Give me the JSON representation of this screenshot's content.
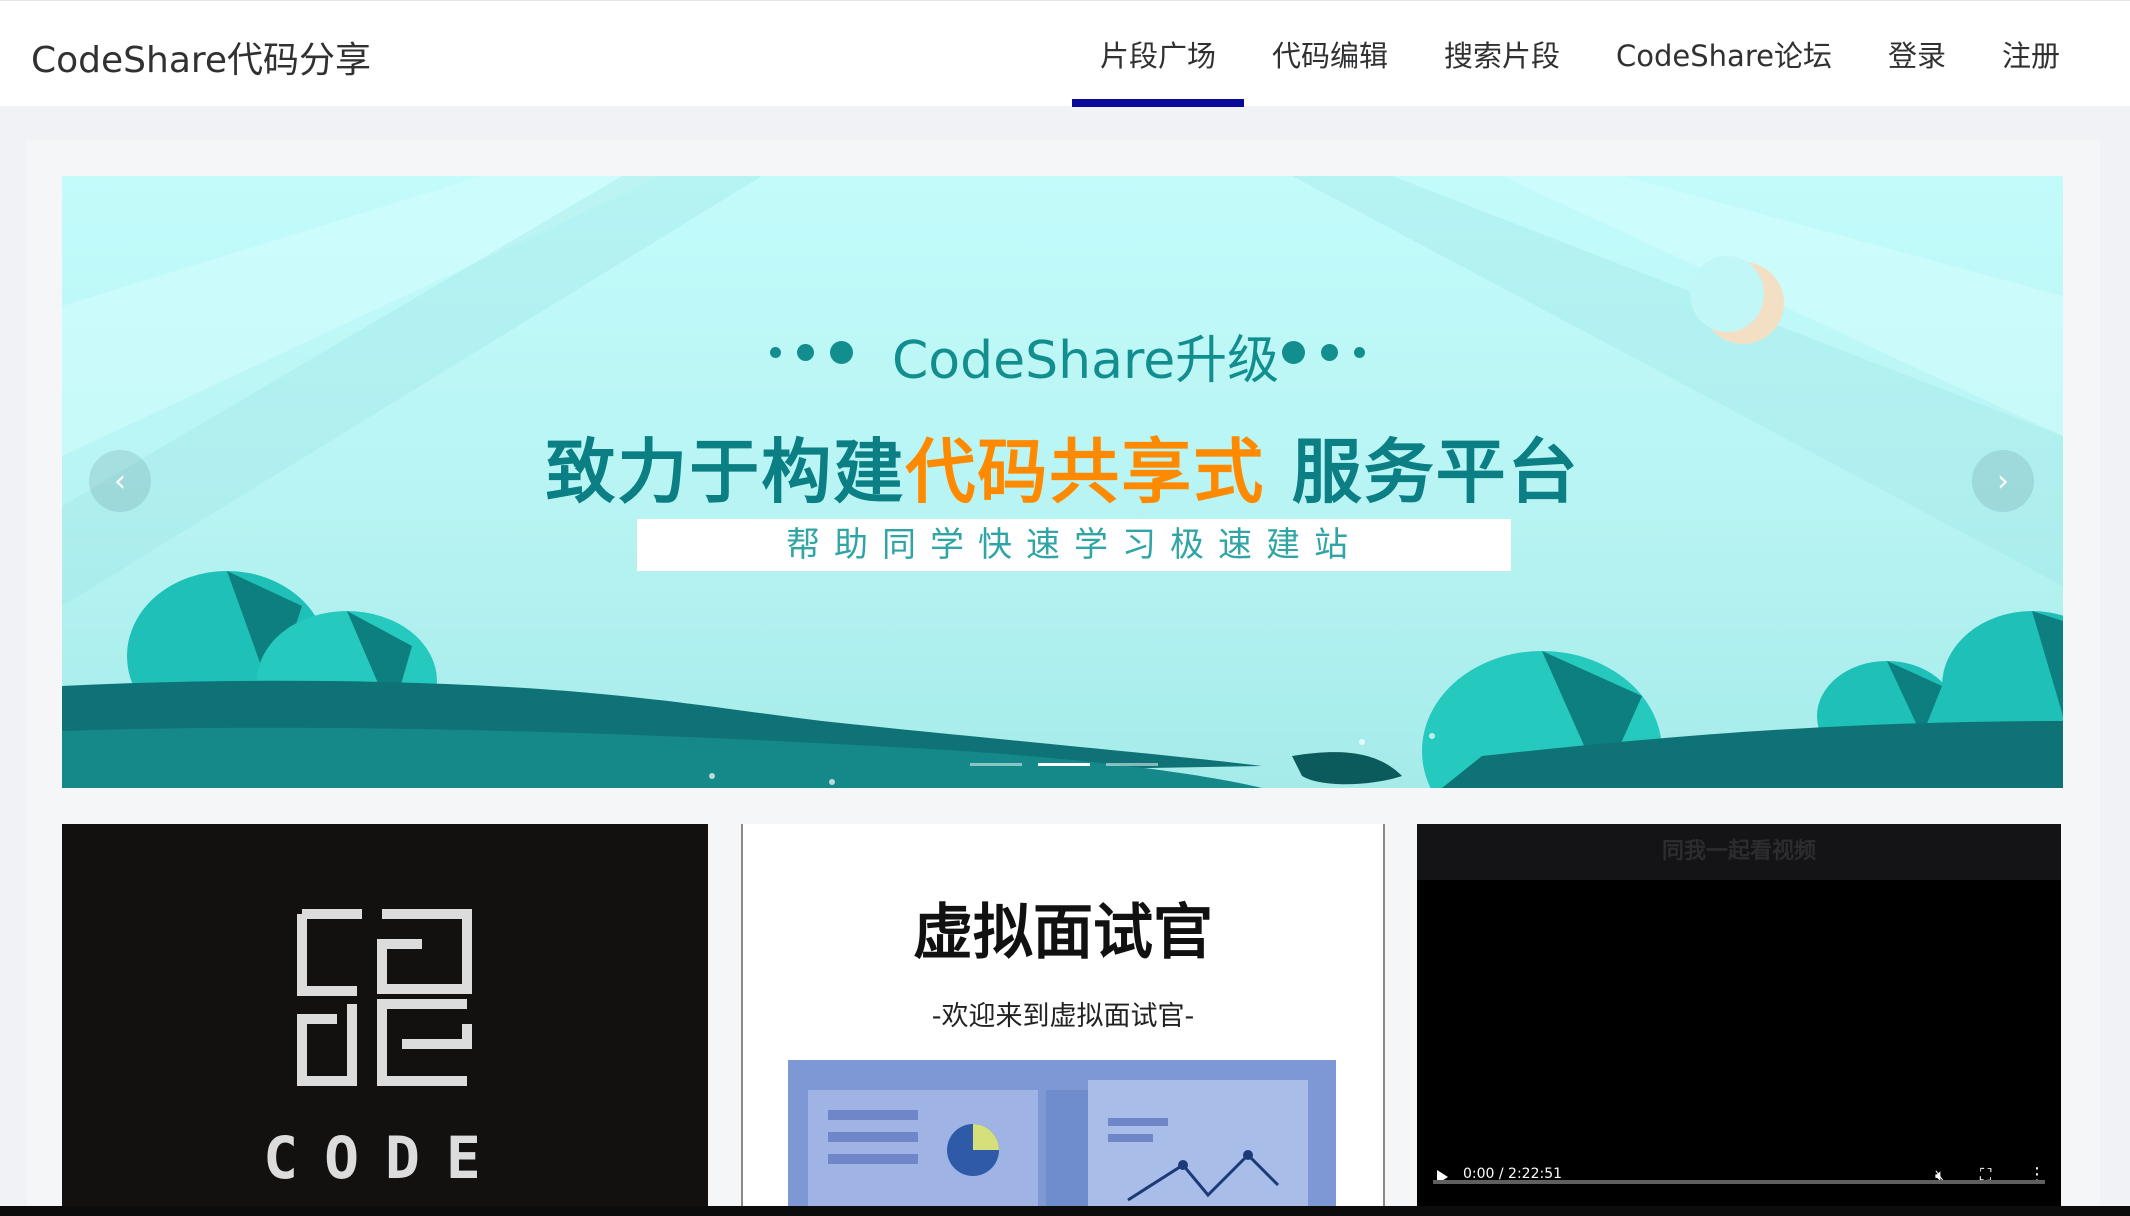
{
  "header": {
    "brand": "CodeShare代码分享",
    "nav": [
      "片段广场",
      "代码编辑",
      "搜索片段",
      "CodeShare论坛",
      "登录",
      "注册"
    ],
    "active_index": 0
  },
  "banner": {
    "kicker": "CodeShare升级",
    "headline_before": "致力于构建",
    "headline_highlight": "代码共享式",
    "headline_after": "服务平台",
    "subtitle": "帮助同学快速学习极速建站",
    "prev_arrow": "‹",
    "next_arrow": "›",
    "indicator_count": 3,
    "active_indicator": 1,
    "colors": {
      "accent": "#0b7f84",
      "highlight": "#ff8a00",
      "sky": "#c3fbfb"
    }
  },
  "cards": {
    "code": {
      "logo_word": "CODE"
    },
    "interview": {
      "title": "虚拟面试官",
      "subtitle": "-欢迎来到虚拟面试官-"
    },
    "video": {
      "title": "同我一起看视频",
      "time": "0:00 / 2:22:51",
      "muted": true
    }
  },
  "icons": {
    "prev": "chevron-left-icon",
    "next": "chevron-right-icon",
    "play": "play-icon",
    "mute": "mute-icon",
    "fullscreen": "fullscreen-icon",
    "more": "more-vertical-icon"
  }
}
